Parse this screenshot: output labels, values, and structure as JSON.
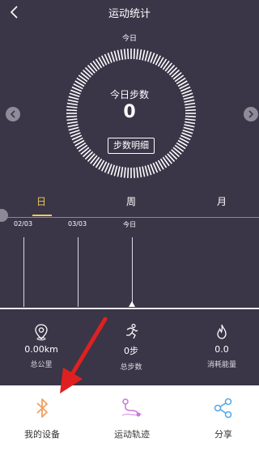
{
  "header": {
    "title": "运动统计",
    "back_icon": "chevron-left-icon"
  },
  "ring": {
    "top_label": "今日",
    "center_label": "今日步数",
    "steps": "0",
    "detail_button": "步数明细",
    "colors": {
      "background": "#3a3648",
      "ticks": "#ffffff"
    }
  },
  "nav_arrows": {
    "prev_icon": "chevron-left-icon",
    "next_icon": "chevron-right-icon"
  },
  "tabs": [
    {
      "label": "日",
      "active": true
    },
    {
      "label": "周",
      "active": false
    },
    {
      "label": "月",
      "active": false
    }
  ],
  "timeline": {
    "dates": [
      "02/03",
      "03/03",
      "今日"
    ]
  },
  "stats": [
    {
      "icon": "location-pin-icon",
      "value": "0.00km",
      "label": "总公里"
    },
    {
      "icon": "running-person-icon",
      "value": "0步",
      "label": "总步数"
    },
    {
      "icon": "flame-icon",
      "value": "0.0",
      "label": "消耗能量"
    }
  ],
  "bottom_nav": [
    {
      "icon": "bluetooth-icon",
      "label": "我的设备",
      "color": "#f0a063"
    },
    {
      "icon": "route-track-icon",
      "label": "运动轨迹",
      "color": "#c878d8"
    },
    {
      "icon": "share-icon",
      "label": "分享",
      "color": "#5aa9e6"
    }
  ],
  "annotation": {
    "arrow_color": "#e02020"
  }
}
